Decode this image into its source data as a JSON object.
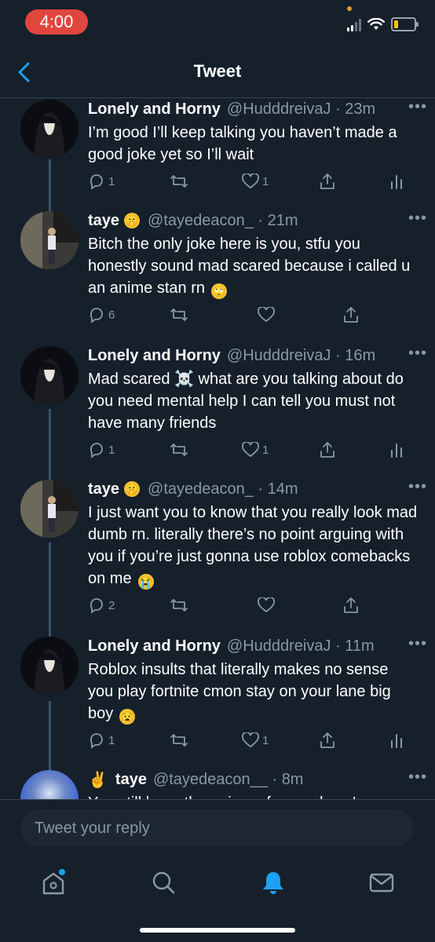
{
  "status_bar": {
    "time": "4:00"
  },
  "header": {
    "title": "Tweet"
  },
  "tweets": [
    {
      "name": "Lonely and Horny",
      "handle": "@HudddreivaJ",
      "time": "23m",
      "text": "I’m good I’ll keep talking you haven’t made a good joke yet so I’ll wait",
      "reply_count": "1",
      "like_count": "1"
    },
    {
      "name": "taye",
      "handle": "@tayedeacon_",
      "time": "21m",
      "text": "Bitch the only joke here is you, stfu you honestly sound mad scared because i called u an anime stan rn",
      "reply_count": "6",
      "like_count": ""
    },
    {
      "name": "Lonely and Horny",
      "handle": "@HudddreivaJ",
      "time": "16m",
      "text_before": "Mad scared",
      "text_after": "what are you talking about do you need mental help I can tell you must not have many friends",
      "reply_count": "1",
      "like_count": "1"
    },
    {
      "name": "taye",
      "handle": "@tayedeacon_",
      "time": "14m",
      "text": "I just want you to know that you really look mad dumb rn. literally there’s no point arguing with you if you’re just  gonna use roblox comebacks on me",
      "reply_count": "2",
      "like_count": ""
    },
    {
      "name": "Lonely and Horny",
      "handle": "@HudddreivaJ",
      "time": "11m",
      "text": "Roblox insults that literally makes no sense you play fortnite cmon stay on your lane big boy",
      "reply_count": "1",
      "like_count": "1"
    },
    {
      "name": "taye",
      "handle": "@tayedeacon__",
      "time": "8m",
      "text": "You still have the anime pfp... and you're"
    }
  ],
  "reply": {
    "placeholder": "Tweet your reply"
  },
  "icons": {
    "reply": "reply-icon",
    "retweet": "retweet-icon",
    "like": "like-icon",
    "share": "share-icon",
    "analytics": "analytics-icon",
    "tabs": [
      "home-icon",
      "search-icon",
      "notifications-icon",
      "messages-icon"
    ]
  },
  "colors": {
    "background": "#15202b",
    "accent": "#1da1f2",
    "muted": "#8899a6",
    "time_pill": "#e0463e"
  }
}
